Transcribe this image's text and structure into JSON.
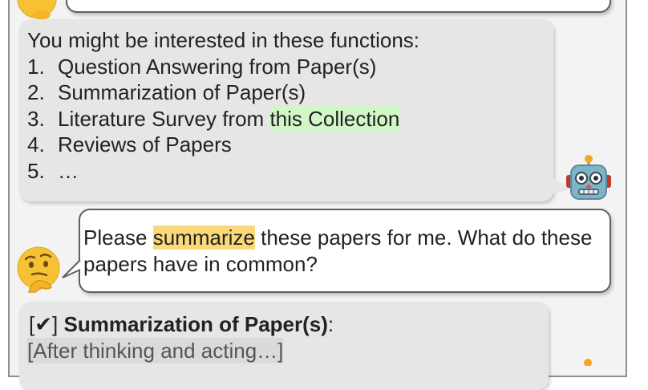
{
  "chat": {
    "bot_message_1": {
      "intro": "You might be interested in these functions:",
      "items": [
        {
          "num": "1.",
          "text": "Question Answering from Paper(s)",
          "highlight": ""
        },
        {
          "num": "2.",
          "text": "Summarization of Paper(s)",
          "highlight": ""
        },
        {
          "num": "3.",
          "text": "Literature Survey from ",
          "highlight": "this Collection"
        },
        {
          "num": "4.",
          "text": "Reviews of Papers",
          "highlight": ""
        },
        {
          "num": "5.",
          "text": "…",
          "highlight": ""
        }
      ]
    },
    "user_message": {
      "before": "Please ",
      "highlight": "summarize",
      "after": " these papers for me. What do these papers have in common?"
    },
    "bot_message_2": {
      "check_open": "[",
      "check_mark": "✔",
      "check_close": "]",
      "function_name": "Summarization of Paper(s)",
      "colon": ":",
      "status_text": "[After thinking and acting…]"
    }
  },
  "icons": {
    "user_avatar": "thinking-face-icon",
    "bot_avatar": "robot-face-icon"
  },
  "colors": {
    "highlight_green": "#d2f7c7",
    "highlight_yellow": "#fbd979",
    "bot_bubble": "#e6e6e6",
    "user_bubble": "#ffffff"
  }
}
